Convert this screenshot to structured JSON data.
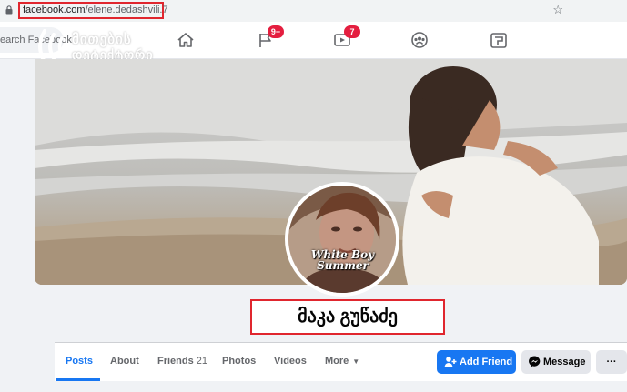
{
  "browser": {
    "url_domain": "facebook.com",
    "url_path": "/elene.dedashvili.7"
  },
  "header": {
    "search_placeholder": "earch Facebook",
    "badges": {
      "flag": "9+",
      "video": "7"
    }
  },
  "watermark": {
    "line1": "მითების",
    "line2": "დეტექტორი"
  },
  "profile": {
    "avatar_text_line1": "White Boy",
    "avatar_text_line2": "Summer",
    "name": "მაკა გუწაძე"
  },
  "tabs": [
    {
      "label": "Posts"
    },
    {
      "label": "About"
    },
    {
      "label": "Friends",
      "count": "21"
    },
    {
      "label": "Photos"
    },
    {
      "label": "Videos"
    },
    {
      "label": "More"
    }
  ],
  "actions": {
    "add_friend": "Add Friend",
    "message": "Message",
    "more": "···"
  },
  "colors": {
    "accent": "#1877f2",
    "highlight": "#e0262e",
    "badge": "#e41e3f"
  }
}
